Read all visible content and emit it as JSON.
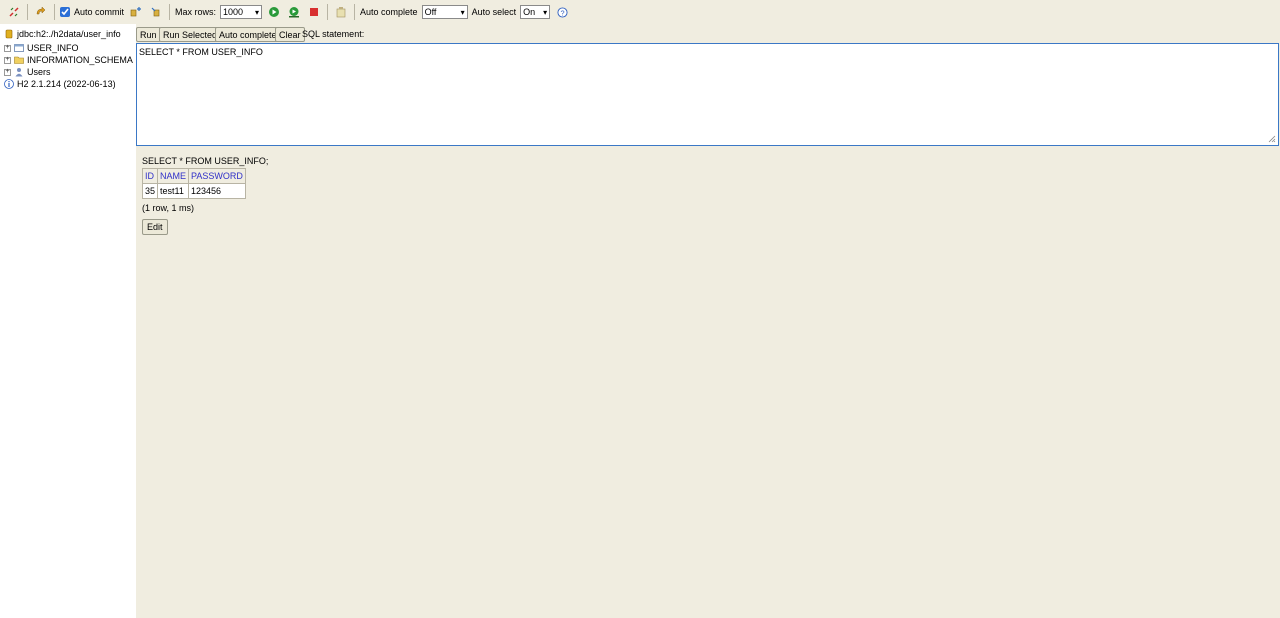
{
  "toolbar": {
    "auto_commit_label": "Auto commit",
    "auto_commit_checked": true,
    "max_rows_label": "Max rows:",
    "max_rows_value": "1000",
    "auto_complete_label": "Auto complete",
    "auto_complete_value": "Off",
    "auto_select_label": "Auto select",
    "auto_select_value": "On"
  },
  "tree": {
    "connection": "jdbc:h2:./h2data/user_info",
    "items": [
      {
        "label": "USER_INFO",
        "icon": "table-icon"
      },
      {
        "label": "INFORMATION_SCHEMA",
        "icon": "folder-icon"
      },
      {
        "label": "Users",
        "icon": "users-icon"
      }
    ],
    "version": "H2 2.1.214 (2022-06-13)"
  },
  "editor": {
    "run_label": "Run",
    "run_selected_label": "Run Selected",
    "auto_complete_label": "Auto complete",
    "clear_label": "Clear",
    "sql_statement_label": "SQL statement:",
    "sql_text": "SELECT * FROM USER_INFO"
  },
  "result": {
    "query": "SELECT * FROM USER_INFO;",
    "columns": [
      "ID",
      "NAME",
      "PASSWORD"
    ],
    "rows": [
      [
        "35",
        "test11",
        "123456"
      ]
    ],
    "summary": "(1 row, 1 ms)",
    "edit_label": "Edit"
  },
  "colors": {
    "panel_bg": "#f0ede0",
    "header_text": "#3030c8",
    "editor_border": "#3b78c6"
  }
}
